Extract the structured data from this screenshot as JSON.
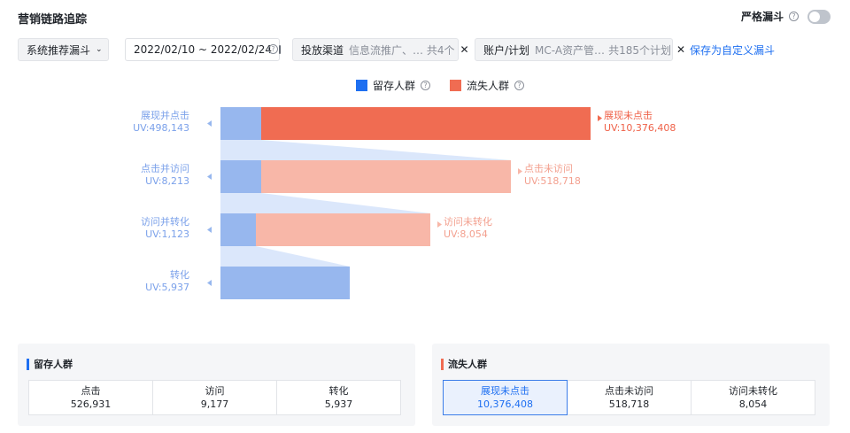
{
  "header": {
    "title": "营销链路追踪",
    "strict_label": "严格漏斗",
    "strict_on": false
  },
  "filters": {
    "funnel_type": "系统推荐漏斗",
    "date_range": "2022/02/10 ~ 2022/02/24",
    "channel_label": "投放渠道",
    "channel_value": "信息流推广、… 共4个",
    "account_label": "账户/计划",
    "account_value": "MC-A资产管…",
    "account_count": "共185个计划",
    "save_link": "保存为自定义漏斗"
  },
  "legend": {
    "retained": "留存人群",
    "lost": "流失人群"
  },
  "colors": {
    "retained": "#97b7ee",
    "retained_legend": "#1e6ff1",
    "lost_strong": "#f06c52",
    "lost_light": "#f8b7a8",
    "connector": "#dbe7fb"
  },
  "funnel": {
    "max_value": 10876551,
    "stages": [
      {
        "left_name": "展现并点击",
        "left_uv": "UV:498,143",
        "retained": 498143,
        "right_name": "展现未点击",
        "right_uv": "UV:10,376,408",
        "lost": 10376408,
        "strong": true
      },
      {
        "left_name": "点击并访问",
        "left_uv": "UV:8,213",
        "retained": 8213,
        "right_name": "点击未访问",
        "right_uv": "UV:518,718",
        "lost": 518718,
        "strong": false
      },
      {
        "left_name": "访问并转化",
        "left_uv": "UV:1,123",
        "retained": 1123,
        "right_name": "访问未转化",
        "right_uv": "UV:8,054",
        "lost": 8054,
        "strong": false
      },
      {
        "left_name": "转化",
        "left_uv": "UV:5,937",
        "retained": 5937,
        "right_name": "",
        "right_uv": "",
        "lost": 0,
        "strong": false
      }
    ]
  },
  "retained_panel": {
    "title": "留存人群",
    "cells": [
      {
        "label": "点击",
        "value": "526,931"
      },
      {
        "label": "访问",
        "value": "9,177"
      },
      {
        "label": "转化",
        "value": "5,937"
      }
    ]
  },
  "lost_panel": {
    "title": "流失人群",
    "cells": [
      {
        "label": "展现未点击",
        "value": "10,376,408",
        "active": true
      },
      {
        "label": "点击未访问",
        "value": "518,718"
      },
      {
        "label": "访问未转化",
        "value": "8,054"
      }
    ]
  }
}
